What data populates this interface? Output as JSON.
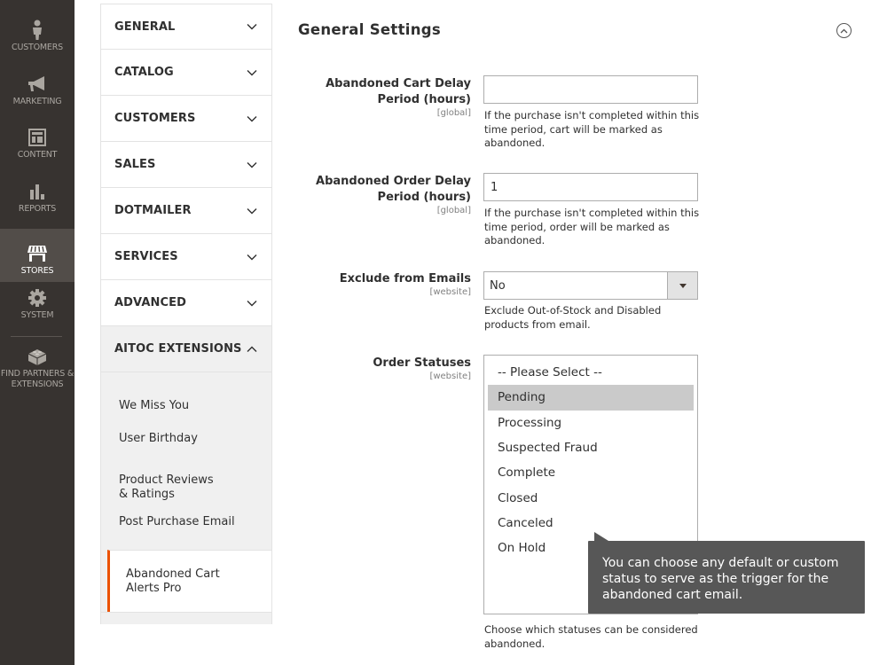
{
  "admin_nav": {
    "items": [
      {
        "label": "Customers",
        "icon": "customer-icon"
      },
      {
        "label": "Marketing",
        "icon": "megaphone-icon"
      },
      {
        "label": "Content",
        "icon": "layout-icon"
      },
      {
        "label": "Reports",
        "icon": "bar-chart-icon"
      },
      {
        "label": "Stores",
        "icon": "store-icon",
        "active": true
      },
      {
        "label": "System",
        "icon": "gear-icon"
      },
      {
        "label": "Find Partners & Extensions",
        "icon": "lego-brick-icon"
      }
    ]
  },
  "config_nav": {
    "sections": [
      {
        "label": "GENERAL"
      },
      {
        "label": "CATALOG"
      },
      {
        "label": "CUSTOMERS"
      },
      {
        "label": "SALES"
      },
      {
        "label": "DOTMAILER"
      },
      {
        "label": "SERVICES"
      },
      {
        "label": "ADVANCED"
      },
      {
        "label": "AITOC EXTENSIONS",
        "expanded": true
      }
    ],
    "sub_items": [
      {
        "label": "We Miss You"
      },
      {
        "label": "User Birthday"
      },
      {
        "label": "Product Reviews & Ratings"
      },
      {
        "label": "Post Purchase Email"
      },
      {
        "label": "Abandoned Cart Alerts Pro",
        "active": true
      }
    ]
  },
  "main": {
    "section_title": "General Settings",
    "fields": {
      "cart_delay": {
        "label": "Abandoned Cart Delay Period (hours)",
        "scope": "[global]",
        "value": "",
        "note": "If the purchase isn't completed within this time period, cart will be marked as abandoned."
      },
      "order_delay": {
        "label": "Abandoned Order Delay Period (hours)",
        "scope": "[global]",
        "value": "1",
        "note": "If the purchase isn't completed within this time period, order will be marked as abandoned."
      },
      "exclude": {
        "label": "Exclude from Emails",
        "scope": "[website]",
        "value": "No",
        "note": "Exclude Out-of-Stock and Disabled products from email."
      },
      "order_statuses": {
        "label": "Order Statuses",
        "scope": "[website]",
        "options": [
          "-- Please Select --",
          "Pending",
          "Processing",
          "Suspected Fraud",
          "Complete",
          "Closed",
          "Canceled",
          "On Hold"
        ],
        "selected": [
          "Pending"
        ],
        "note": "Choose which statuses can be considered abandoned."
      }
    },
    "tooltip": "You can choose any default or custom status to serve as the trigger for the abandoned cart email."
  },
  "colors": {
    "accent": "#eb5202",
    "admin_nav_bg": "#373330",
    "admin_nav_active": "#524d49",
    "tooltip_bg": "#575757",
    "selected_option": "#cacaca"
  }
}
